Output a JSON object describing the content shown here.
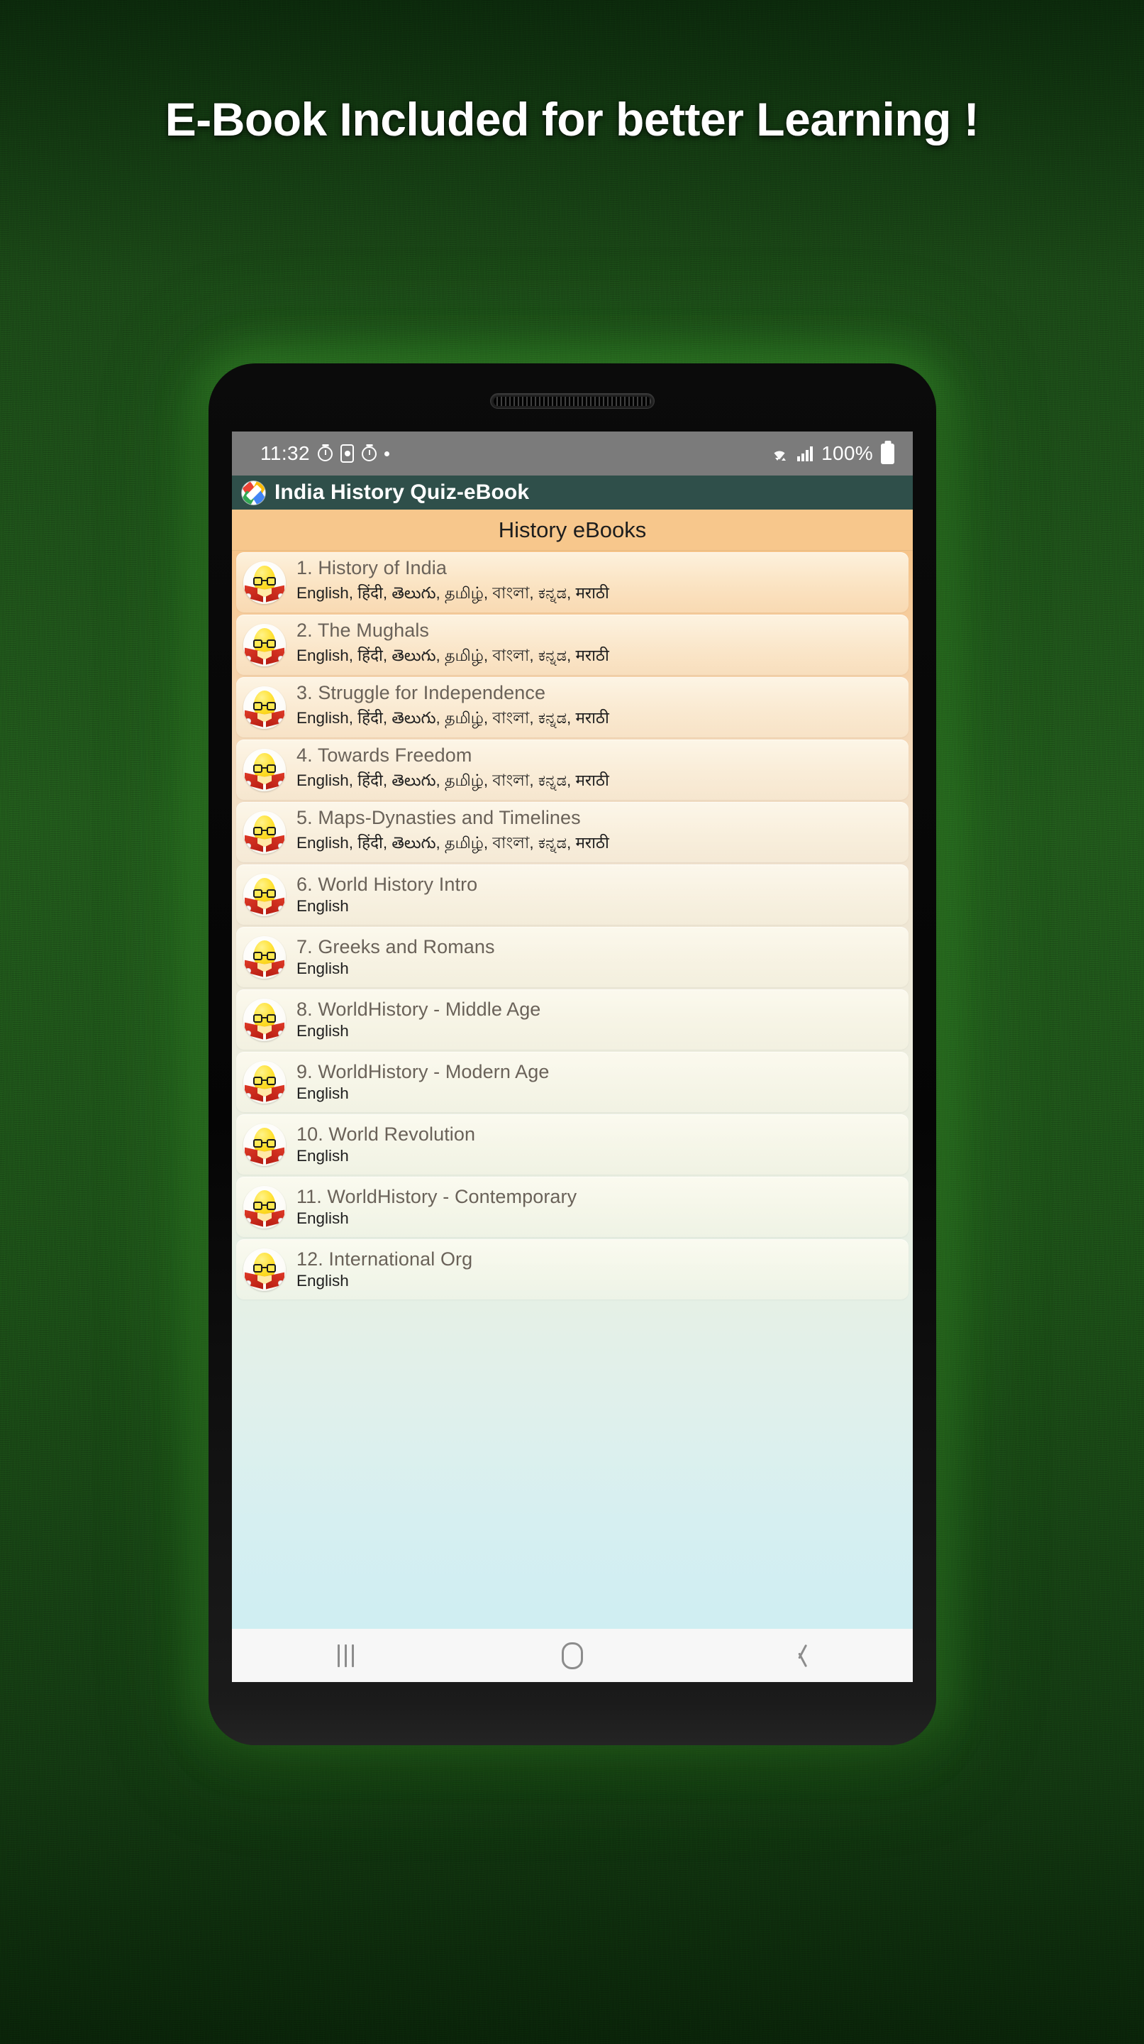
{
  "promo": {
    "headline": "E-Book Included for better Learning !",
    "background_color": "#1c4a18",
    "headline_color": "#ffffff"
  },
  "status_bar": {
    "time": "11:32",
    "battery_text": "100%",
    "icons": [
      "timer-icon",
      "screen-recorder-icon",
      "timer-icon",
      "dot-icon",
      "wifi-icon",
      "cellular-signal-icon",
      "battery-icon"
    ],
    "background_color": "#7b7b7b"
  },
  "app_bar": {
    "title": "India History Quiz-eBook",
    "logo": "app-logo-icon",
    "background_color": "#2f4f4a",
    "title_color": "#ffffff"
  },
  "list_header": {
    "title": "History eBooks",
    "background_color": "#f7c78c"
  },
  "ebooks": [
    {
      "title": "1. History of India",
      "languages": "English, हिंदी, తెలుగు, தமிழ், বাংলা, ಕನ್ನಡ, मराठी"
    },
    {
      "title": "2. The Mughals",
      "languages": "English, हिंदी, తెలుగు, தமிழ், বাংলা, ಕನ್ನಡ, मराठी"
    },
    {
      "title": "3. Struggle for Independence",
      "languages": "English, हिंदी, తెలుగు, தமிழ், বাংলা, ಕನ್ನಡ, मराठी"
    },
    {
      "title": "4. Towards Freedom",
      "languages": "English, हिंदी, తెలుగు, தமிழ், বাংলা, ಕನ್ನಡ, मराठी"
    },
    {
      "title": "5. Maps-Dynasties and Timelines",
      "languages": "English, हिंदी, తెలుగు, தமிழ், বাংলা, ಕನ್ನಡ, मराठी"
    },
    {
      "title": "6. World History Intro",
      "languages": "English"
    },
    {
      "title": "7. Greeks and Romans",
      "languages": "English"
    },
    {
      "title": "8. WorldHistory - Middle Age",
      "languages": "English"
    },
    {
      "title": "9. WorldHistory - Modern Age",
      "languages": "English"
    },
    {
      "title": "10. World Revolution",
      "languages": "English"
    },
    {
      "title": "11. WorldHistory - Contemporary",
      "languages": "English"
    },
    {
      "title": "12. International Org",
      "languages": "English"
    }
  ],
  "nav_bar": {
    "recents_label": "Recents",
    "home_label": "Home",
    "back_label": "Back",
    "background_color": "#f7f7f7"
  }
}
